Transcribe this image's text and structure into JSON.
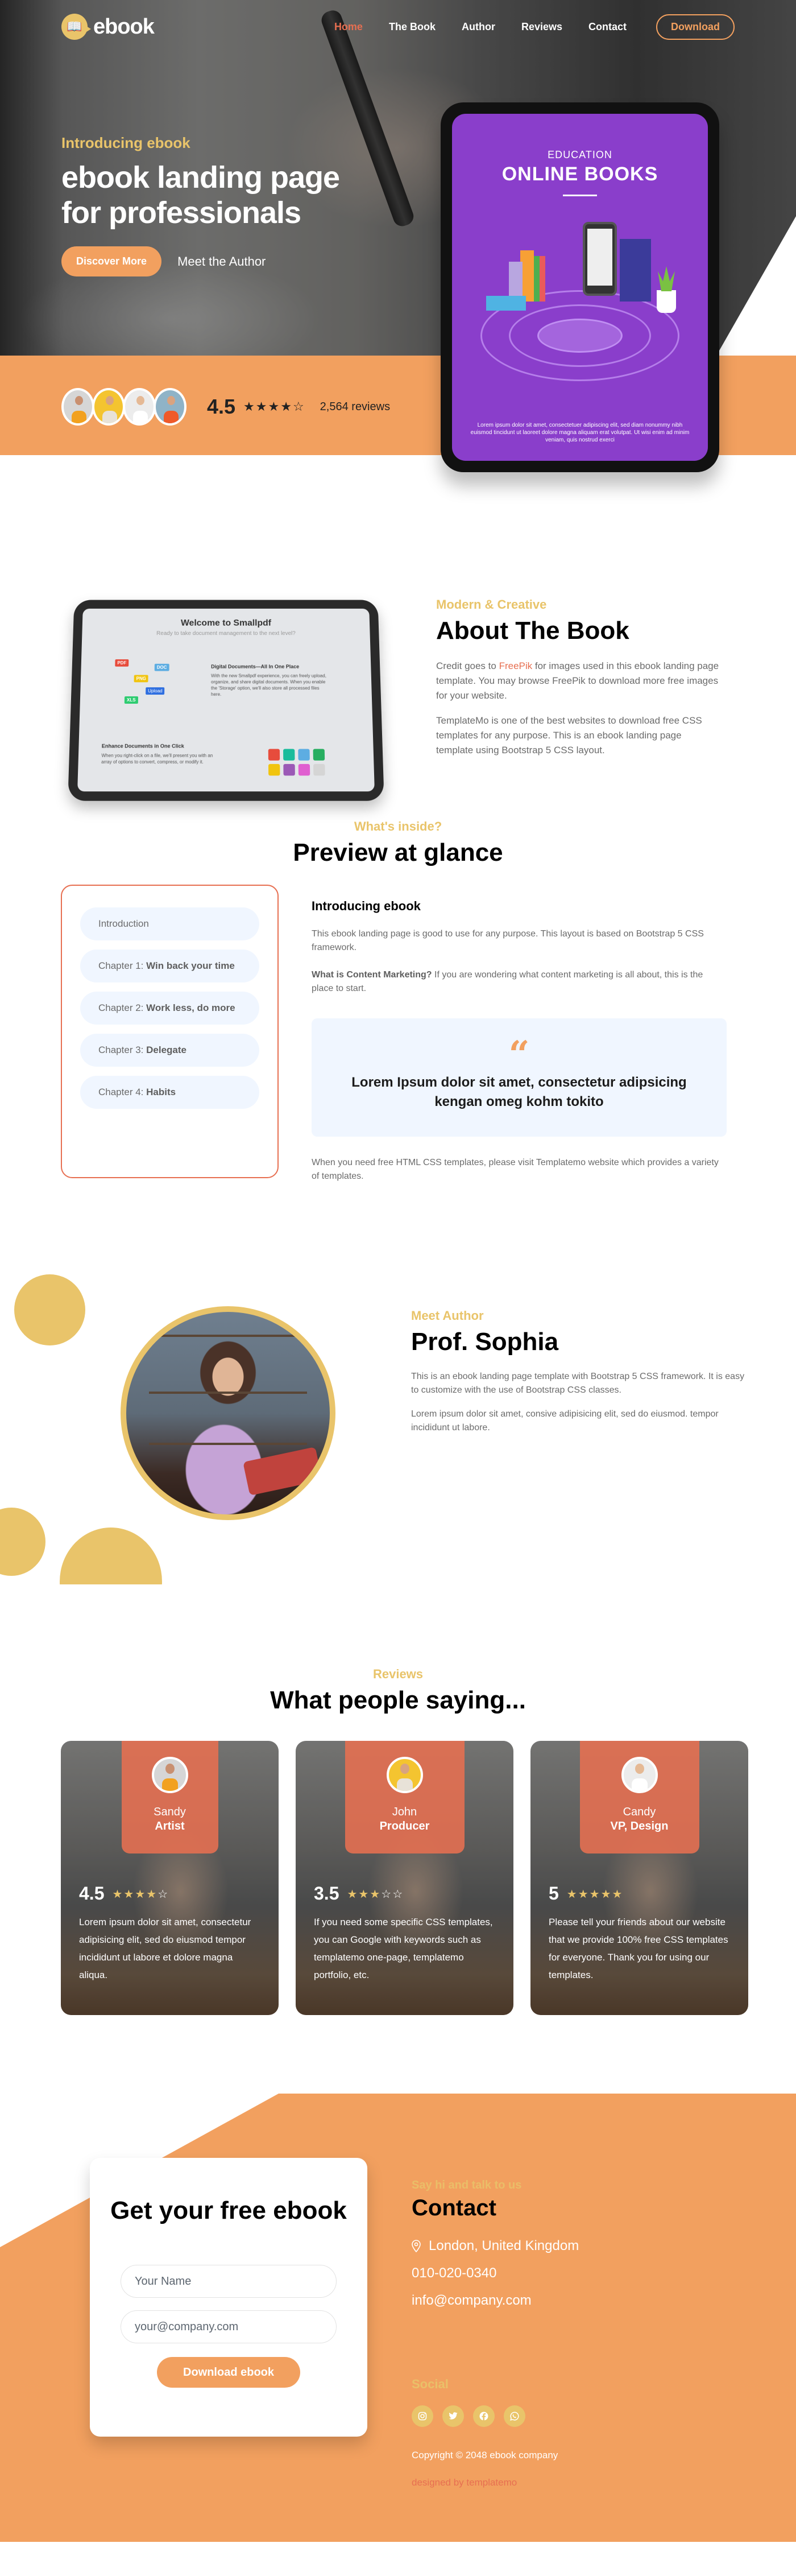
{
  "colors": {
    "accent_orange": "#f2a05f",
    "accent_red": "#e76f51",
    "accent_yellow": "#e9c46a",
    "light_blue_bg": "#f0f6ff"
  },
  "nav": {
    "logo_text": "ebook",
    "logo_icon": "book-icon",
    "links": [
      {
        "label": "Home",
        "active": true
      },
      {
        "label": "The Book"
      },
      {
        "label": "Author"
      },
      {
        "label": "Reviews"
      },
      {
        "label": "Contact"
      }
    ],
    "download_label": "Download"
  },
  "hero": {
    "subtitle": "Introducing ebook",
    "title_line1": "ebook landing page",
    "title_line2": "for professionals",
    "discover_label": "Discover More",
    "author_link_label": "Meet the Author",
    "rating": "4.5",
    "stars": 4.5,
    "reviews_count": "2,564 reviews",
    "tablet": {
      "eyebrow": "EDUCATION",
      "title": "ONLINE BOOKS",
      "lorem": "Lorem ipsum dolor sit amet, consectetuer adipiscing elit, sed diam nonummy nibh euismod tincidunt ut laoreet dolore magna aliquam erat volutpat. Ut wisi enim ad minim veniam, quis nostrud exerci"
    }
  },
  "about": {
    "eyebrow": "Modern & Creative",
    "title": "About The Book",
    "para1_prefix": "Credit goes to ",
    "para1_link": "FreePik",
    "para1_suffix": " for images used in this ebook landing page template. You may browse FreePik to download more free images for your website.",
    "para2": "TemplateMo is one of the best websites to download free CSS templates for any purpose. This is an ebook landing page template using Bootstrap 5 CSS layout.",
    "device_screen": {
      "title": "Welcome to Smallpdf",
      "subtitle": "Ready to take document management to the next level?",
      "tags": [
        "PDF",
        "DOC",
        "PNG",
        "XLS"
      ],
      "upload_label": "Upload",
      "h1": "Digital Documents—All In One Place",
      "p1": "With the new Smallpdf experience, you can freely upload, organize, and share digital documents. When you enable the 'Storage' option, we'll also store all processed files here.",
      "h2": "Enhance Documents in One Click",
      "p2": "When you right-click on a file, we'll present you with an array of options to convert, compress, or modify it."
    }
  },
  "preview": {
    "eyebrow": "What's inside?",
    "title": "Preview at glance",
    "toc": [
      {
        "prefix": "Introduction",
        "bold": ""
      },
      {
        "prefix": "Chapter 1: ",
        "bold": "Win back your time"
      },
      {
        "prefix": "Chapter 2: ",
        "bold": "Work less, do more"
      },
      {
        "prefix": "Chapter 3: ",
        "bold": "Delegate"
      },
      {
        "prefix": "Chapter 4: ",
        "bold": "Habits"
      }
    ],
    "heading": "Introducing ebook",
    "para1": "This ebook landing page is good to use for any purpose. This layout is based on Bootstrap 5 CSS framework.",
    "para2_bold": "What is Content Marketing?",
    "para2_rest": " If you are wondering what content marketing is all about, this is the place to start.",
    "quote_icon": "quote-icon",
    "quote": "Lorem Ipsum dolor sit amet, consectetur adipsicing kengan omeg kohm tokito",
    "para3": "When you need free HTML CSS templates, please visit Templatemo website which provides a variety of templates."
  },
  "author": {
    "eyebrow": "Meet Author",
    "name": "Prof. Sophia",
    "para1": "This is an ebook landing page template with Bootstrap 5 CSS framework. It is easy to customize with the use of Bootstrap CSS classes.",
    "para2": "Lorem ipsum dolor sit amet, consive adipisicing elit, sed do eiusmod. tempor incididunt ut labore."
  },
  "reviews": {
    "eyebrow": "Reviews",
    "title": "What people saying...",
    "items": [
      {
        "name": "Sandy",
        "role": "Artist",
        "score": "4.5",
        "stars": 4,
        "text": "Lorem ipsum dolor sit amet, consectetur adipisicing elit, sed do eiusmod tempor incididunt ut labore et dolore magna aliqua."
      },
      {
        "name": "John",
        "role": "Producer",
        "score": "3.5",
        "stars": 3,
        "text": "If you need some specific CSS templates, you can Google with keywords such as templatemo one-page, templatemo portfolio, etc."
      },
      {
        "name": "Candy",
        "role": "VP, Design",
        "score": "5",
        "stars": 5,
        "text": "Please tell your friends about our website that we provide 100% free CSS templates for everyone. Thank you for using our templates."
      }
    ]
  },
  "form": {
    "title": "Get your free ebook",
    "name_placeholder": "Your Name",
    "email_placeholder": "your@company.com",
    "submit_label": "Download ebook"
  },
  "contact": {
    "eyebrow": "Say hi and talk to us",
    "title": "Contact",
    "location": "London, United Kingdom",
    "phone": "010-020-0340",
    "email": "info@company.com",
    "social_title": "Social",
    "socials": [
      "instagram-icon",
      "twitter-icon",
      "facebook-icon",
      "whatsapp-icon"
    ],
    "copyright": "Copyright © 2048 ebook company",
    "designed_by": "designed by templatemo"
  }
}
